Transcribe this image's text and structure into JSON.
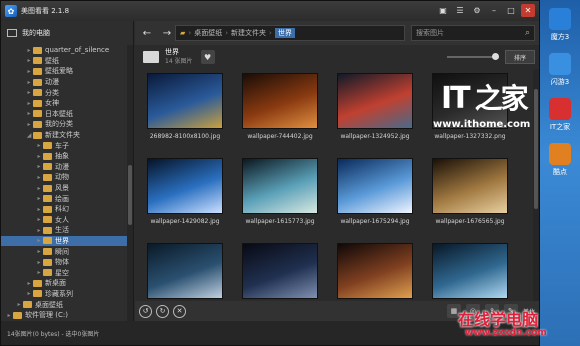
{
  "app": {
    "title": "美图看看 2.1.8"
  },
  "sidebar": {
    "header": "我的电脑",
    "tree": [
      {
        "label": "quarter_of_silence",
        "indent": 2,
        "expanded": false,
        "selected": false
      },
      {
        "label": "壁纸",
        "indent": 2,
        "expanded": false,
        "selected": false
      },
      {
        "label": "壁纸爱略",
        "indent": 2,
        "expanded": false,
        "selected": false
      },
      {
        "label": "动漫",
        "indent": 2,
        "expanded": false,
        "selected": false
      },
      {
        "label": "分类",
        "indent": 2,
        "expanded": false,
        "selected": false
      },
      {
        "label": "女神",
        "indent": 2,
        "expanded": false,
        "selected": false
      },
      {
        "label": "日本壁纸",
        "indent": 2,
        "expanded": false,
        "selected": false
      },
      {
        "label": "我的分类",
        "indent": 2,
        "expanded": false,
        "selected": false
      },
      {
        "label": "新建文件夹",
        "indent": 2,
        "expanded": true,
        "selected": false
      },
      {
        "label": "车子",
        "indent": 3,
        "expanded": false,
        "selected": false
      },
      {
        "label": "抽象",
        "indent": 3,
        "expanded": false,
        "selected": false
      },
      {
        "label": "动漫",
        "indent": 3,
        "expanded": false,
        "selected": false
      },
      {
        "label": "动物",
        "indent": 3,
        "expanded": false,
        "selected": false
      },
      {
        "label": "风景",
        "indent": 3,
        "expanded": false,
        "selected": false
      },
      {
        "label": "绘画",
        "indent": 3,
        "expanded": false,
        "selected": false
      },
      {
        "label": "科幻",
        "indent": 3,
        "expanded": false,
        "selected": false
      },
      {
        "label": "女人",
        "indent": 3,
        "expanded": false,
        "selected": false
      },
      {
        "label": "生活",
        "indent": 3,
        "expanded": false,
        "selected": false
      },
      {
        "label": "世界",
        "indent": 3,
        "expanded": false,
        "selected": true
      },
      {
        "label": "瞬间",
        "indent": 3,
        "expanded": false,
        "selected": false
      },
      {
        "label": "物体",
        "indent": 3,
        "expanded": false,
        "selected": false
      },
      {
        "label": "星空",
        "indent": 3,
        "expanded": false,
        "selected": false
      },
      {
        "label": "新桌面",
        "indent": 2,
        "expanded": false,
        "selected": false
      },
      {
        "label": "珍藏系列",
        "indent": 2,
        "expanded": false,
        "selected": false
      },
      {
        "label": "桌面壁纸",
        "indent": 1,
        "expanded": false,
        "selected": false
      },
      {
        "label": "软件管理 (C:)",
        "indent": 0,
        "expanded": false,
        "selected": false
      }
    ]
  },
  "toolbar": {
    "back": "←",
    "forward": "→",
    "path": [
      "桌面壁纸",
      "新建文件夹",
      "世界"
    ],
    "search_placeholder": "搜索图片"
  },
  "folder": {
    "name": "世界",
    "count": "14 张图片",
    "sort_label": "排序"
  },
  "thumbnails": [
    {
      "filename": "268982-8100x8100.jpg",
      "colors": [
        "#0a1a3a",
        "#2a5a9a",
        "#c9a040"
      ]
    },
    {
      "filename": "wallpaper-744402.jpg",
      "colors": [
        "#1a0d08",
        "#8a3a10",
        "#e09040"
      ]
    },
    {
      "filename": "wallpaper-1324952.jpg",
      "colors": [
        "#101a28",
        "#c04030",
        "#4a6a8a"
      ]
    },
    {
      "filename": "wallpaper-1327332.png",
      "colors": [
        "#101010",
        "#2a2a2a",
        "#555"
      ]
    },
    {
      "filename": "wallpaper-1429082.jpg",
      "colors": [
        "#061428",
        "#2a70c0",
        "#cce0ff"
      ]
    },
    {
      "filename": "wallpaper-1615773.jpg",
      "colors": [
        "#0c1820",
        "#5aa0b8",
        "#d8e8e0"
      ]
    },
    {
      "filename": "wallpaper-1675294.jpg",
      "colors": [
        "#0a2a5a",
        "#5a9ad8",
        "#f0f4ff"
      ]
    },
    {
      "filename": "wallpaper-1676565.jpg",
      "colors": [
        "#1a1008",
        "#a07840",
        "#e8d0a0"
      ]
    },
    {
      "filename": "",
      "colors": [
        "#0a1a28",
        "#2a5070",
        "#c0d0e0"
      ]
    },
    {
      "filename": "",
      "colors": [
        "#080a14",
        "#203050",
        "#8090b0"
      ]
    },
    {
      "filename": "",
      "colors": [
        "#100808",
        "#804020",
        "#e0a050"
      ]
    },
    {
      "filename": "",
      "colors": [
        "#081828",
        "#306890",
        "#b0d8f0"
      ]
    }
  ],
  "bottombar": {
    "rotate_left": "↺",
    "rotate_right": "↻",
    "delete": "✕",
    "beautify_label": "美化"
  },
  "status": "14张图片(0 bytes) - 选中0张图片",
  "dock": [
    {
      "label": "魔方3",
      "color": "#2a80d8"
    },
    {
      "label": "闪游3",
      "color": "#3a90e0"
    },
    {
      "label": "IT之家",
      "color": "#d83030"
    },
    {
      "label": "酷点",
      "color": "#e08020"
    }
  ],
  "watermarks": {
    "it_logo": "IT",
    "it_zh": "之家",
    "url": "www.ithome.com",
    "site": "在线学电脑",
    "site_url": "www.zxxdn.com"
  }
}
